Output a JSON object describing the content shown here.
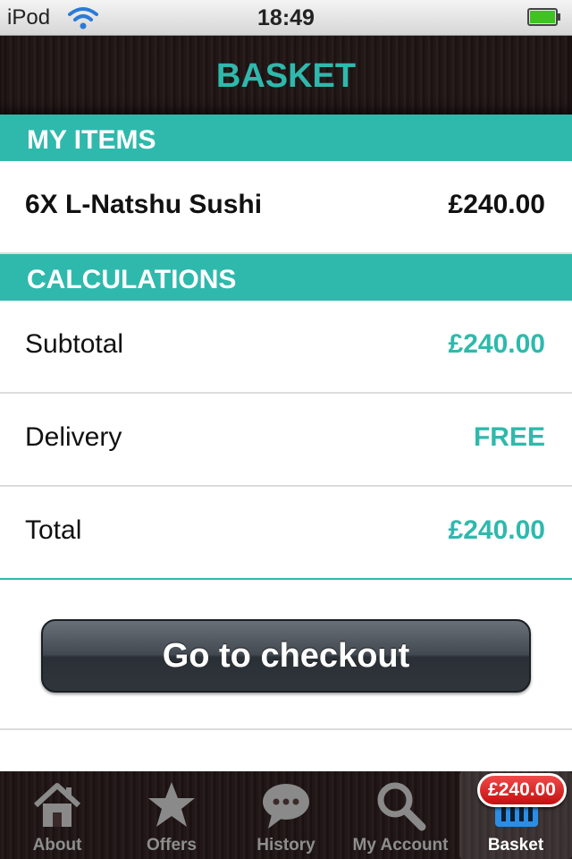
{
  "status_bar": {
    "carrier": "iPod",
    "time": "18:49"
  },
  "nav": {
    "title": "BASKET"
  },
  "my_items": {
    "header": "MY ITEMS",
    "items": [
      {
        "name": "6X L-Natshu Sushi",
        "price": "£240.00"
      }
    ]
  },
  "calculations": {
    "header": "CALCULATIONS",
    "subtotal": {
      "label": "Subtotal",
      "value": "£240.00"
    },
    "delivery": {
      "label": "Delivery",
      "value": "FREE"
    },
    "total": {
      "label": "Total",
      "value": "£240.00"
    }
  },
  "checkout": {
    "label": "Go to checkout"
  },
  "tabbar": {
    "tabs": [
      {
        "label": "About",
        "icon": "house-icon"
      },
      {
        "label": "Offers",
        "icon": "star-icon"
      },
      {
        "label": "History",
        "icon": "speech-bubble-icon"
      },
      {
        "label": "My Account",
        "icon": "magnifier-icon"
      },
      {
        "label": "Basket",
        "icon": "basket-icon",
        "active": true
      }
    ],
    "basket_badge": "£240.00"
  },
  "colors": {
    "accent": "#2fb9ac",
    "badge": "#d41a1a",
    "bar_dark": "#1e1414"
  }
}
